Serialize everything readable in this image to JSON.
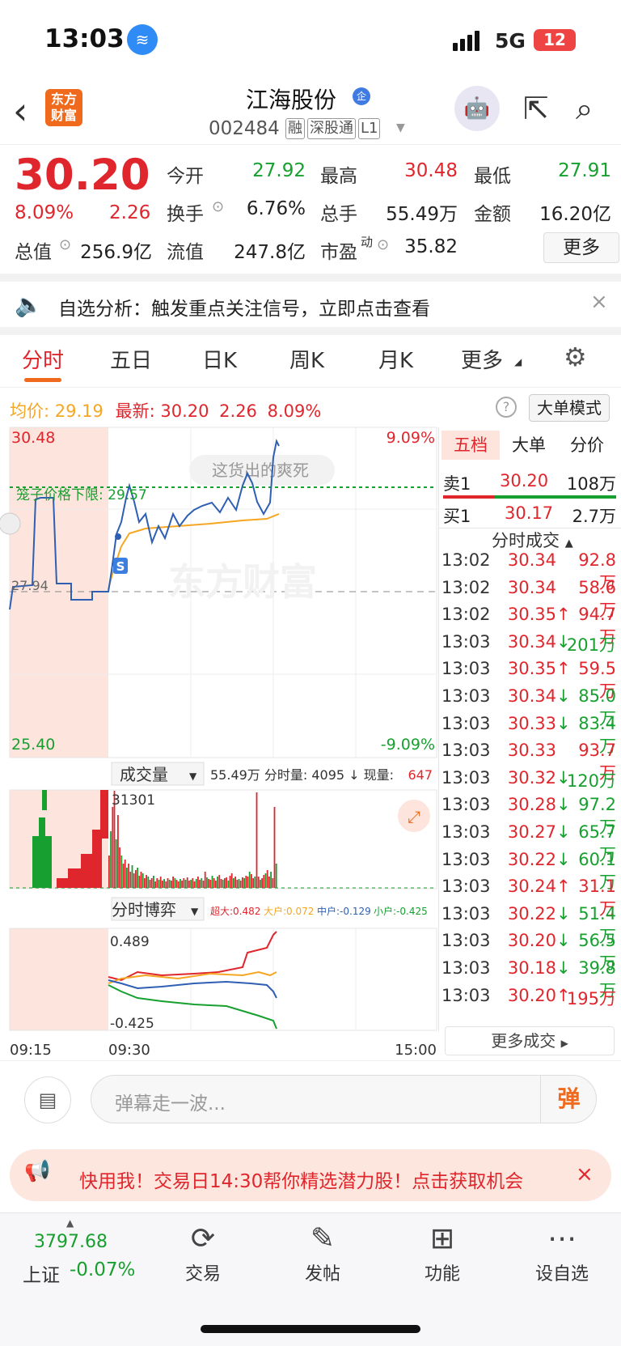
{
  "status": {
    "time": "13:03",
    "network": "5G",
    "battery": "12"
  },
  "header": {
    "logo": "东方财富",
    "stock_name": "江海股份",
    "badge": "企",
    "code": "002484",
    "tags": [
      "融",
      "深股通",
      "L1"
    ]
  },
  "quote": {
    "price": "30.20",
    "change_pct": "8.09%",
    "change": "2.26",
    "fields": [
      {
        "label": "今开",
        "value": "27.92",
        "color": "green"
      },
      {
        "label": "最高",
        "value": "30.48",
        "color": "red"
      },
      {
        "label": "最低",
        "value": "27.91",
        "color": "green"
      },
      {
        "label": "换手",
        "value": "6.76%",
        "color": "black"
      },
      {
        "label": "总手",
        "value": "55.49万",
        "color": "black"
      },
      {
        "label": "金额",
        "value": "16.20亿",
        "color": "black"
      },
      {
        "label": "总值",
        "value": "256.9亿",
        "color": "black"
      },
      {
        "label": "流值",
        "value": "247.8亿",
        "color": "black"
      },
      {
        "label": "市盈",
        "value": "35.82",
        "color": "black",
        "sup": "动"
      }
    ],
    "more": "更多"
  },
  "notice": {
    "text": "自选分析：触发重点关注信号，立即点击查看"
  },
  "tabs": [
    "分时",
    "五日",
    "日K",
    "周K",
    "月K",
    "更多"
  ],
  "info": {
    "avg_label": "均价:",
    "avg": "29.19",
    "latest_label": "最新:",
    "latest": "30.20",
    "chg": "2.26",
    "pct": "8.09%",
    "mode": "大单模式"
  },
  "chart": {
    "max_price": "30.48",
    "min_price": "25.40",
    "prev_close": "27.94",
    "max_pct": "9.09%",
    "min_pct": "-9.09%",
    "limit_label": "笼子价格下限: 29.57",
    "danmu": "这货出的爽死",
    "watermark": "东方财富",
    "vol_label": "成交量",
    "vol_info": "55.49万 分时量: 4095 ↓ 现量:",
    "vol_now": "647",
    "vol_max": "31301",
    "game_label": "分时博弈",
    "game_vals": [
      {
        "label": "超大:0.482",
        "color": "#e0262d"
      },
      {
        "label": "大户:0.072",
        "color": "#f5a623"
      },
      {
        "label": "中户:-0.129",
        "color": "#2f5fb3"
      },
      {
        "label": "小户:-0.425",
        "color": "#17a02f"
      }
    ],
    "game_max": "0.489",
    "game_min": "-0.425",
    "time_labels": [
      "09:15",
      "09:30",
      "15:00"
    ],
    "s_marker": "S"
  },
  "orderbook": {
    "tabs": [
      "五档",
      "大单",
      "分价"
    ],
    "sell1": {
      "label": "卖1",
      "price": "30.20",
      "vol": "108万"
    },
    "buy1": {
      "label": "买1",
      "price": "30.17",
      "vol": "2.7万"
    },
    "trades_title": "分时成交",
    "trades": [
      {
        "t": "13:02",
        "p": "30.34",
        "a": "",
        "v": "92.8万",
        "c": "red"
      },
      {
        "t": "13:02",
        "p": "30.34",
        "a": "",
        "v": "58.6万",
        "c": "red"
      },
      {
        "t": "13:02",
        "p": "30.35",
        "a": "↑",
        "v": "94.7万",
        "c": "red"
      },
      {
        "t": "13:03",
        "p": "30.34",
        "a": "↓",
        "v": "201万",
        "c": "green"
      },
      {
        "t": "13:03",
        "p": "30.35",
        "a": "↑",
        "v": "59.5万",
        "c": "red"
      },
      {
        "t": "13:03",
        "p": "30.34",
        "a": "↓",
        "v": "85.0万",
        "c": "green"
      },
      {
        "t": "13:03",
        "p": "30.33",
        "a": "↓",
        "v": "83.4万",
        "c": "green"
      },
      {
        "t": "13:03",
        "p": "30.33",
        "a": "",
        "v": "93.7万",
        "c": "red"
      },
      {
        "t": "13:03",
        "p": "30.32",
        "a": "↓",
        "v": "120万",
        "c": "green"
      },
      {
        "t": "13:03",
        "p": "30.28",
        "a": "↓",
        "v": "97.2万",
        "c": "green"
      },
      {
        "t": "13:03",
        "p": "30.27",
        "a": "↓",
        "v": "65.7万",
        "c": "green"
      },
      {
        "t": "13:03",
        "p": "30.22",
        "a": "↓",
        "v": "60.1万",
        "c": "green"
      },
      {
        "t": "13:03",
        "p": "30.24",
        "a": "↑",
        "v": "31.1万",
        "c": "red"
      },
      {
        "t": "13:03",
        "p": "30.22",
        "a": "↓",
        "v": "51.4万",
        "c": "green"
      },
      {
        "t": "13:03",
        "p": "30.20",
        "a": "↓",
        "v": "56.5万",
        "c": "green"
      },
      {
        "t": "13:03",
        "p": "30.18",
        "a": "↓",
        "v": "39.8万",
        "c": "green"
      },
      {
        "t": "13:03",
        "p": "30.20",
        "a": "↑",
        "v": "195万",
        "c": "red"
      }
    ],
    "more": "更多成交"
  },
  "danmu": {
    "placeholder": "弹幕走一波...",
    "button": "弹"
  },
  "promo": {
    "text": "快用我！交易日14:30帮你精选潜力股！点击获取机会"
  },
  "nav": {
    "index_value": "3797.68",
    "index_name": "上证",
    "index_pct": "-0.07%",
    "items": [
      "交易",
      "发帖",
      "功能",
      "设自选"
    ]
  }
}
